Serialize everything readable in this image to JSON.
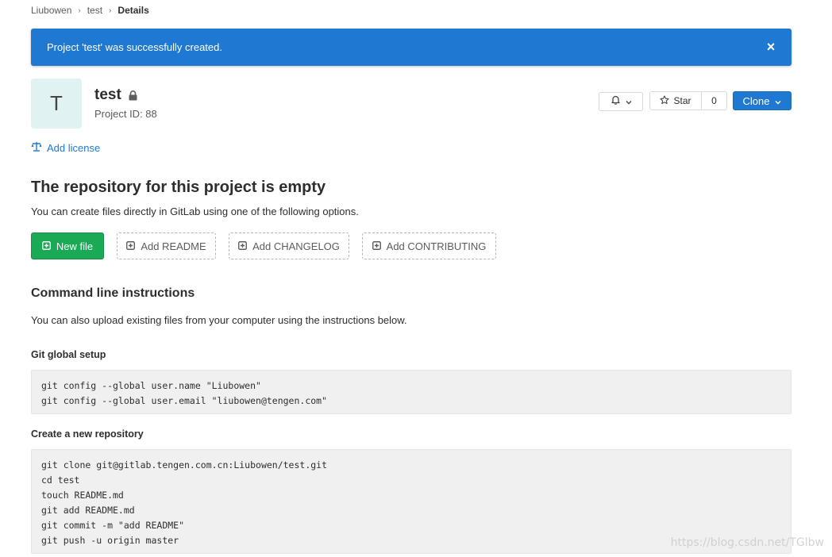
{
  "breadcrumb": {
    "items": [
      "Liubowen",
      "test"
    ],
    "current": "Details"
  },
  "flash": {
    "message": "Project 'test' was successfully created.",
    "close_glyph": "×"
  },
  "project": {
    "avatar_letter": "T",
    "name": "test",
    "id_text": "Project ID: 88"
  },
  "actions": {
    "star_label": "Star",
    "star_count": "0",
    "clone_label": "Clone"
  },
  "license": {
    "label": "Add license"
  },
  "empty": {
    "title": "The repository for this project is empty",
    "description": "You can create files directly in GitLab using one of the following options.",
    "buttons": {
      "new_file": "New file",
      "readme": "Add README",
      "changelog": "Add CHANGELOG",
      "contributing": "Add CONTRIBUTING"
    }
  },
  "cli": {
    "title": "Command line instructions",
    "description": "You can also upload existing files from your computer using the instructions below.",
    "global_setup": {
      "heading": "Git global setup",
      "lines": [
        "git config --global user.name \"Liubowen\"",
        "git config --global user.email \"liubowen@tengen.com\""
      ]
    },
    "new_repo": {
      "heading": "Create a new repository",
      "lines": [
        "git clone git@gitlab.tengen.com.cn:Liubowen/test.git",
        "cd test",
        "touch README.md",
        "git add README.md",
        "git commit -m \"add README\"",
        "git push -u origin master"
      ]
    }
  },
  "watermark": "https://blog.csdn.net/TGlbw",
  "colors": {
    "primary": "#1f78d1",
    "success": "#1aaa55",
    "avatar_bg": "#e0f2f1",
    "code_bg": "#f0f0f0"
  }
}
